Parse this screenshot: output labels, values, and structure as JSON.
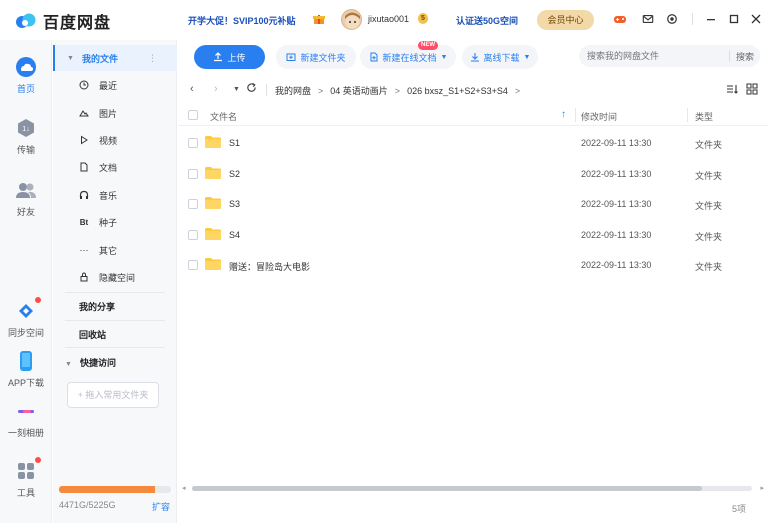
{
  "app": {
    "title": "百度网盘"
  },
  "header": {
    "promo": "开学大促！SVIP100元补贴",
    "username": "jixutao001",
    "vip_badge": "5",
    "verify": "认证送50G空间",
    "member_button": "会员中心"
  },
  "rail": {
    "items": [
      {
        "label": "首页"
      },
      {
        "label": "传输"
      },
      {
        "label": "好友"
      },
      {
        "label": "同步空间"
      },
      {
        "label": "APP下载"
      },
      {
        "label": "一刻相册"
      },
      {
        "label": "工具"
      }
    ]
  },
  "nav": {
    "my_files": "我的文件",
    "items": [
      {
        "label": "最近",
        "icon": "clock-icon"
      },
      {
        "label": "图片",
        "icon": "image-icon"
      },
      {
        "label": "视频",
        "icon": "play-icon"
      },
      {
        "label": "文档",
        "icon": "document-icon"
      },
      {
        "label": "音乐",
        "icon": "headphones-icon"
      },
      {
        "label": "种子",
        "icon": "bt-icon"
      },
      {
        "label": "其它",
        "icon": "more-icon"
      },
      {
        "label": "隐藏空间",
        "icon": "lock-icon"
      }
    ],
    "my_share": "我的分享",
    "recycle": "回收站",
    "quick_access": "快捷访问",
    "drag_hint": "+ 拖入常用文件夹",
    "storage_text": "4471G/5225G",
    "storage_fraction": 0.856,
    "expand": "扩容"
  },
  "toolbar": {
    "upload": "上传",
    "new_folder": "新建文件夹",
    "new_doc": "新建在线文档",
    "new_badge": "NEW",
    "offline": "离线下载",
    "search_placeholder": "搜索我的网盘文件",
    "search_button": "搜索"
  },
  "breadcrumb": {
    "items": [
      "我的网盘",
      "04 英语动画片",
      "026 bxsz_S1+S2+S3+S4"
    ]
  },
  "table": {
    "headers": {
      "name": "文件名",
      "time": "修改时间",
      "type": "类型"
    },
    "rows": [
      {
        "name": "S1",
        "time": "2022-09-11 13:30",
        "type": "文件夹"
      },
      {
        "name": "S2",
        "time": "2022-09-11 13:30",
        "type": "文件夹"
      },
      {
        "name": "S3",
        "time": "2022-09-11 13:30",
        "type": "文件夹"
      },
      {
        "name": "S4",
        "time": "2022-09-11 13:30",
        "type": "文件夹"
      },
      {
        "name": "赠送：冒险岛大电影",
        "time": "2022-09-11 13:30",
        "type": "文件夹"
      }
    ]
  },
  "footer": {
    "count": "5项"
  },
  "colors": {
    "accent": "#2a7ff0",
    "folder": "#ffc83d",
    "storage": "#f58a3c"
  }
}
